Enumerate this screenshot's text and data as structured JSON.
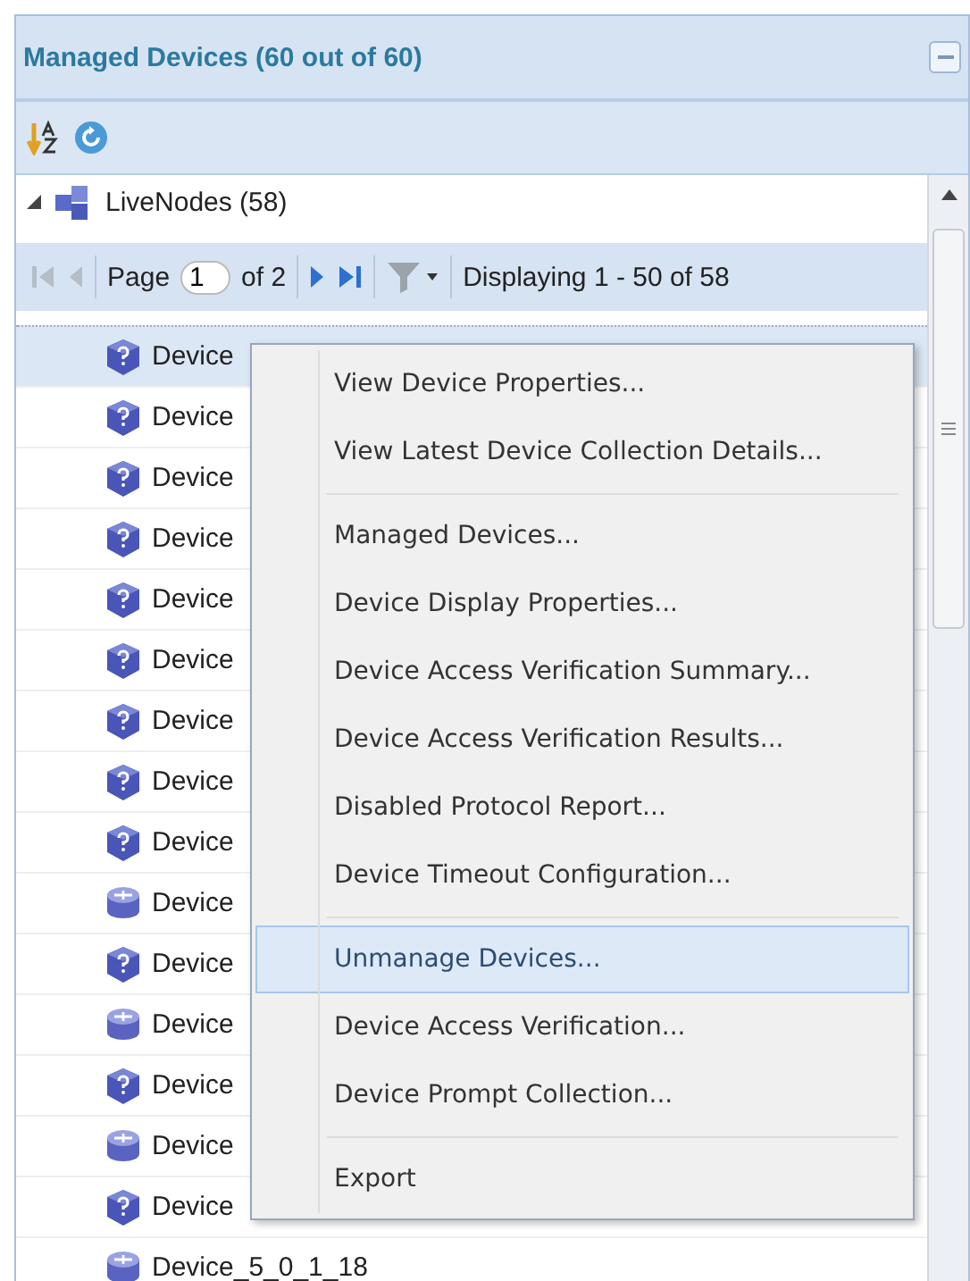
{
  "panel": {
    "title": "Managed Devices (60 out of 60)"
  },
  "tree": {
    "root": {
      "label": "LiveNodes (58)",
      "expanded": true
    }
  },
  "pager": {
    "page_label": "Page",
    "page_value": "1",
    "of_label": "of 2",
    "display": "Displaying 1 - 50 of 58"
  },
  "devices": [
    {
      "label": "Device",
      "kind": "unknown",
      "selected": true
    },
    {
      "label": "Device",
      "kind": "unknown",
      "selected": false
    },
    {
      "label": "Device",
      "kind": "unknown",
      "selected": false
    },
    {
      "label": "Device",
      "kind": "unknown",
      "selected": false
    },
    {
      "label": "Device",
      "kind": "unknown",
      "selected": false
    },
    {
      "label": "Device",
      "kind": "unknown",
      "selected": false
    },
    {
      "label": "Device",
      "kind": "unknown",
      "selected": false
    },
    {
      "label": "Device",
      "kind": "unknown",
      "selected": false
    },
    {
      "label": "Device",
      "kind": "unknown",
      "selected": false
    },
    {
      "label": "Device",
      "kind": "router",
      "selected": false
    },
    {
      "label": "Device",
      "kind": "unknown",
      "selected": false
    },
    {
      "label": "Device",
      "kind": "router",
      "selected": false
    },
    {
      "label": "Device",
      "kind": "unknown",
      "selected": false
    },
    {
      "label": "Device",
      "kind": "router",
      "selected": false
    },
    {
      "label": "Device",
      "kind": "unknown",
      "selected": false
    },
    {
      "label": "Device_5_0_1_18",
      "kind": "router",
      "selected": false
    }
  ],
  "context_menu": [
    {
      "kind": "item",
      "label": "View Device Properties...",
      "selected": false
    },
    {
      "kind": "item",
      "label": "View Latest Device Collection Details...",
      "selected": false
    },
    {
      "kind": "separator"
    },
    {
      "kind": "item",
      "label": "Managed Devices...",
      "selected": false
    },
    {
      "kind": "item",
      "label": "Device Display Properties...",
      "selected": false
    },
    {
      "kind": "item",
      "label": "Device Access Verification Summary...",
      "selected": false
    },
    {
      "kind": "item",
      "label": "Device Access Verification Results...",
      "selected": false
    },
    {
      "kind": "item",
      "label": "Disabled Protocol Report...",
      "selected": false
    },
    {
      "kind": "item",
      "label": "Device Timeout Configuration...",
      "selected": false
    },
    {
      "kind": "separator"
    },
    {
      "kind": "item",
      "label": "Unmanage Devices...",
      "selected": true
    },
    {
      "kind": "item",
      "label": "Device Access Verification...",
      "selected": false
    },
    {
      "kind": "item",
      "label": "Device Prompt Collection...",
      "selected": false
    },
    {
      "kind": "separator"
    },
    {
      "kind": "item",
      "label": "Export",
      "selected": false
    }
  ]
}
